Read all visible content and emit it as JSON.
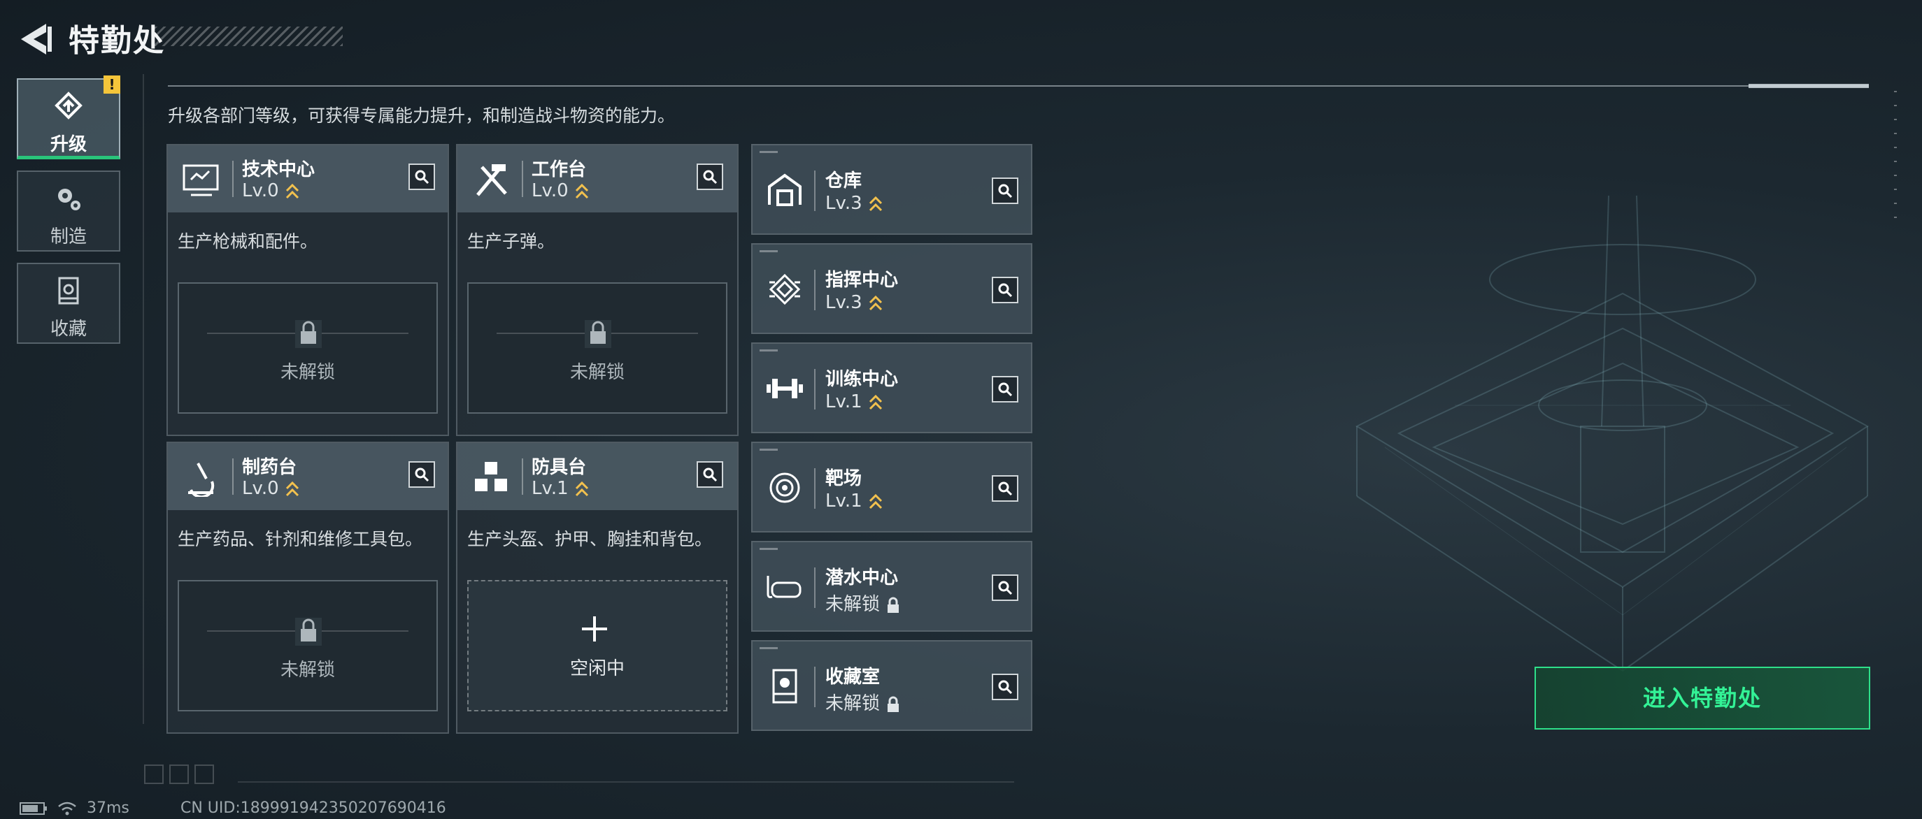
{
  "header": {
    "title": "特勤处"
  },
  "nav": {
    "tabs": [
      {
        "label": "升级",
        "active": true,
        "icon": "upgrade-icon"
      },
      {
        "label": "制造",
        "active": false,
        "icon": "gears-icon"
      },
      {
        "label": "收藏",
        "active": false,
        "icon": "collection-icon"
      }
    ],
    "alert_badge": "!"
  },
  "description": "升级各部门等级，可获得专属能力提升，和制造战斗物资的能力。",
  "workshops": [
    {
      "name": "技术中心",
      "level": "Lv.0",
      "desc": "生产枪械和配件。",
      "slot_label": "未解锁",
      "slot_state": "locked",
      "icon": "monitor-icon"
    },
    {
      "name": "工作台",
      "level": "Lv.0",
      "desc": "生产子弹。",
      "slot_label": "未解锁",
      "slot_state": "locked",
      "icon": "hammer-wrench-icon"
    },
    {
      "name": "制药台",
      "level": "Lv.0",
      "desc": "生产药品、针剂和维修工具包。",
      "slot_label": "未解锁",
      "slot_state": "locked",
      "icon": "microscope-icon"
    },
    {
      "name": "防具台",
      "level": "Lv.1",
      "desc": "生产头盔、护甲、胸挂和背包。",
      "slot_label": "空闲中",
      "slot_state": "idle",
      "icon": "cubes-icon"
    }
  ],
  "facilities": [
    {
      "name": "仓库",
      "level": "Lv.3",
      "locked": false,
      "icon": "warehouse-icon"
    },
    {
      "name": "指挥中心",
      "level": "Lv.3",
      "locked": false,
      "icon": "chip-icon"
    },
    {
      "name": "训练中心",
      "level": "Lv.1",
      "locked": false,
      "icon": "dumbbell-icon"
    },
    {
      "name": "靶场",
      "level": "Lv.1",
      "locked": false,
      "icon": "target-icon"
    },
    {
      "name": "潜水中心",
      "level": "未解锁",
      "locked": true,
      "icon": "diving-mask-icon"
    },
    {
      "name": "收藏室",
      "level": "未解锁",
      "locked": true,
      "icon": "display-case-icon"
    }
  ],
  "enter_button": "进入特勤处",
  "status": {
    "ping": "37ms",
    "uid": "CN UID:18999194235020769041​6"
  },
  "colors": {
    "accent_green": "#2ee08a",
    "level_gold": "#f2c14e",
    "alert_yellow": "#f5c53a"
  }
}
